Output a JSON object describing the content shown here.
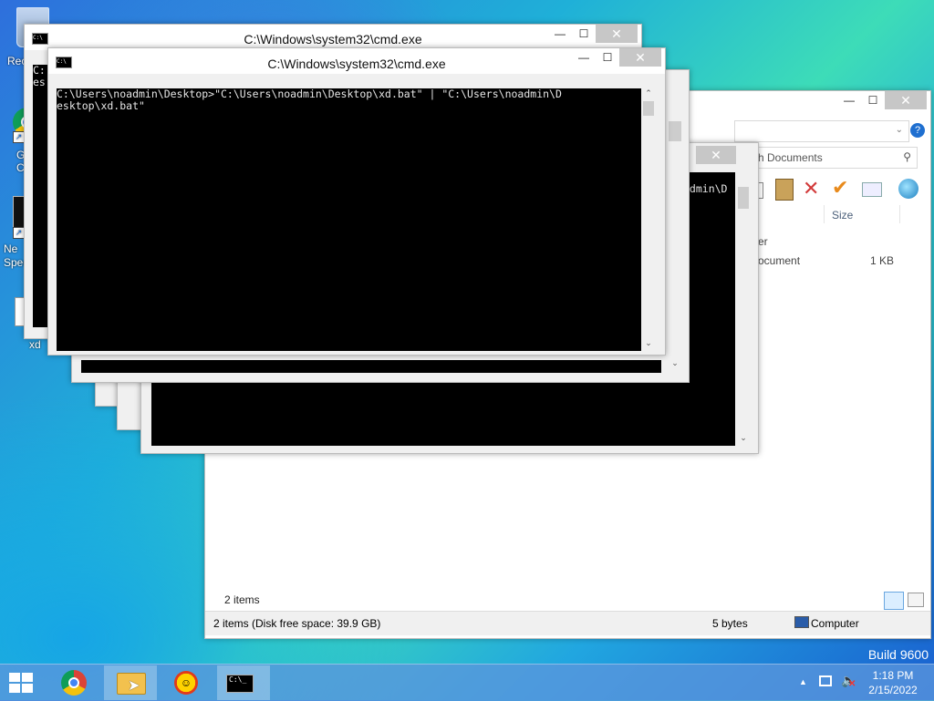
{
  "desktop": {
    "icons": [
      {
        "label": "Rec",
        "icon": "recycle-bin-icon"
      },
      {
        "label": "G\nC",
        "icon": "chrome-icon"
      },
      {
        "label": "Ne\nSpee",
        "icon": "app-icon"
      },
      {
        "label": "xd",
        "icon": "batch-file-icon"
      }
    ],
    "watermark": "Build 9600"
  },
  "explorer": {
    "search_placeholder": "ch Documents",
    "columns": [
      "Size"
    ],
    "rows": [
      {
        "type": "er",
        "size": ""
      },
      {
        "type": "ocument",
        "size": "1 KB"
      }
    ],
    "items_count": "2 items",
    "status_left": "2 items (Disk free space: 39.9 GB)",
    "status_size": "5 bytes",
    "status_location": "Computer"
  },
  "cmd_windows": {
    "title": "C:\\Windows\\system32\\cmd.exe",
    "back_left_text": "C:\nes",
    "mid_text": "admin\\D",
    "front_console": "C:\\Users\\noadmin\\Desktop>\"C:\\Users\\noadmin\\Desktop\\xd.bat\" | \"C:\\Users\\noadmin\\D\nesktop\\xd.bat\""
  },
  "taskbar": {
    "apps": [
      {
        "name": "chrome",
        "icon": "chrome-icon"
      },
      {
        "name": "file-explorer",
        "icon": "folder-icon"
      },
      {
        "name": "sun-app",
        "icon": "smiley-sun-icon"
      },
      {
        "name": "cmd",
        "icon": "cmd-icon"
      }
    ],
    "time": "1:18 PM",
    "date": "2/15/2022"
  }
}
